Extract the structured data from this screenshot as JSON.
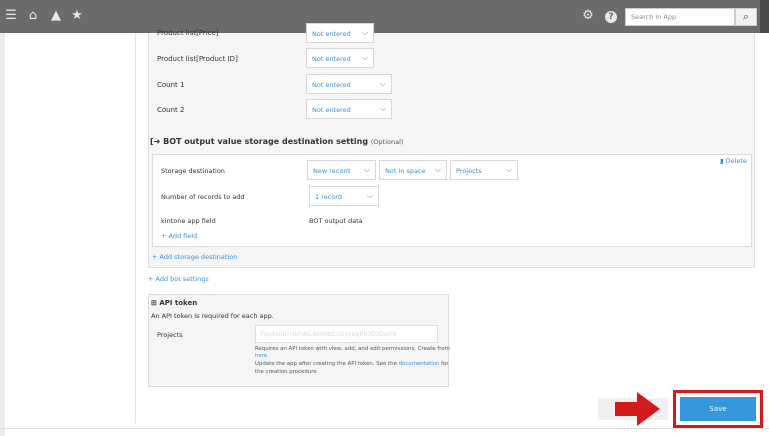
{
  "topbar": {
    "search_placeholder": "Search in App",
    "icons": [
      "menu-icon",
      "home-icon",
      "bell-icon",
      "star-icon",
      "gear-icon",
      "help-icon",
      "search-icon"
    ]
  },
  "input_rows": [
    {
      "label": "Product list[Price]",
      "value": "Not entered"
    },
    {
      "label": "Product list[Product ID]",
      "value": "Not entered"
    },
    {
      "label": "Count 1",
      "value": "Not entered"
    },
    {
      "label": "Count 2",
      "value": "Not entered"
    }
  ],
  "storage_section": {
    "title": "BOT output value storage destination setting",
    "optional": "(Optional)",
    "delete_label": "Delete",
    "storage_destination_label": "Storage destination",
    "storage_selects": [
      "New record",
      "Not in space",
      "Projects"
    ],
    "records_label": "Number of records to add",
    "records_value": "1 record",
    "field_label": "kintone app field",
    "field_value": "BOT output data",
    "add_field": "+ Add field",
    "add_storage": "+ Add storage destination",
    "add_bot": "+ Add bot settings"
  },
  "api": {
    "title": "API token",
    "subtitle": "An API token is required for each app.",
    "projects_label": "Projects",
    "token_value": "Yqq4xmi7HkFd6L4oW8zCo2xyVqRb3E0GwhN",
    "help_line1": "Requires an API token with view, add, and edit permissions. Create from",
    "help_here": "here",
    "help_line2a": "Update the app after creating the API token. See the",
    "help_doc": "documentation",
    "help_line2b": "for",
    "help_line3": "the creation procedure"
  },
  "footer": {
    "save_label": "Save"
  },
  "colors": {
    "accent": "#3498db",
    "highlight": "#d4191d"
  }
}
